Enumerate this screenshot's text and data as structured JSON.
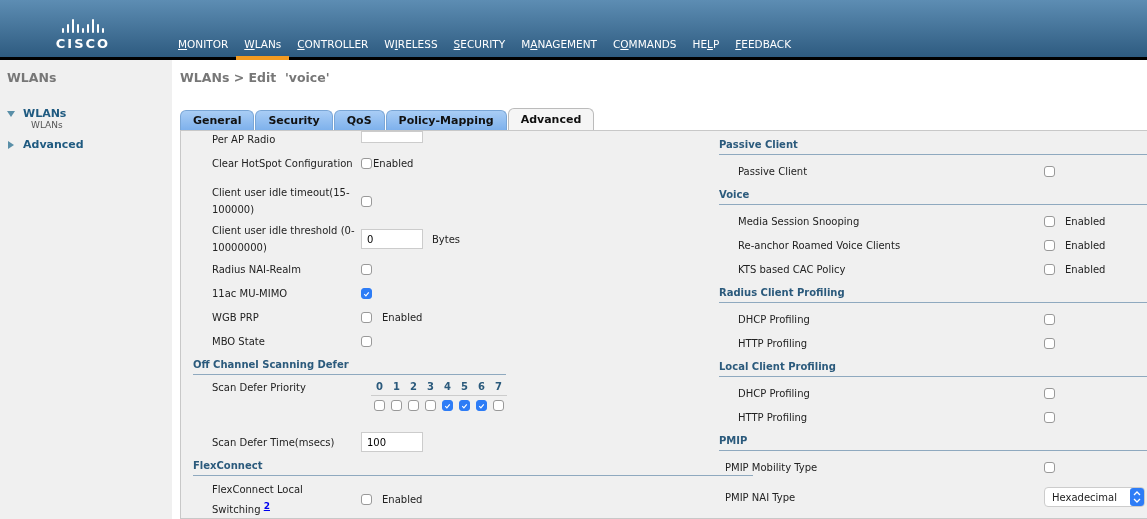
{
  "logo": "CISCO",
  "nav": [
    {
      "key": "M",
      "post": "ONITOR",
      "selected": false
    },
    {
      "key": "W",
      "post": "LANs",
      "selected": true
    },
    {
      "key": "C",
      "post": "ONTROLLER",
      "selected": false
    },
    {
      "pre": "W",
      "key": "I",
      "post": "RELESS",
      "selected": false
    },
    {
      "key": "S",
      "post": "ECURITY",
      "selected": false
    },
    {
      "pre": "M",
      "key": "A",
      "post": "NAGEMENT",
      "selected": false
    },
    {
      "pre": "C",
      "key": "O",
      "post": "MMANDS",
      "selected": false
    },
    {
      "pre": "HE",
      "key": "L",
      "post": "P",
      "selected": false
    },
    {
      "key": "F",
      "post": "EEDBACK",
      "selected": false
    }
  ],
  "sidebar": {
    "title": "WLANs",
    "items": [
      {
        "label": "WLANs",
        "expanded": true,
        "children": [
          {
            "label": "WLANs"
          }
        ]
      },
      {
        "label": "Advanced",
        "expanded": false
      }
    ]
  },
  "page_title": "WLANs > Edit  'voice'",
  "tabs": [
    {
      "label": "General",
      "selected": false
    },
    {
      "label": "Security",
      "selected": false
    },
    {
      "label": "QoS",
      "selected": false
    },
    {
      "label": "Policy-Mapping",
      "selected": false
    },
    {
      "label": "Advanced",
      "selected": true
    }
  ],
  "left": [
    {
      "kind": "input",
      "label": "Per AP Radio"
    },
    {
      "kind": "checkbox",
      "label": "Clear HotSpot Configuration",
      "checked": false,
      "enabled_text": "Enabled"
    },
    {
      "kind": "checkbox",
      "label": "Client user idle timeout(15-100000)",
      "checked": false
    },
    {
      "kind": "input",
      "label": "Client user idle threshold (0-10000000)",
      "value": "0",
      "suffix": "Bytes"
    },
    {
      "kind": "checkbox",
      "label": "Radius NAI-Realm",
      "checked": false
    },
    {
      "kind": "checkbox",
      "label": "11ac MU-MIMO",
      "checked": true
    },
    {
      "kind": "checkbox",
      "label": "WGB PRP",
      "checked": false,
      "enabled_text": "Enabled"
    },
    {
      "kind": "checkbox",
      "label": "MBO State",
      "checked": false
    },
    {
      "kind": "header",
      "label": "Off Channel Scanning Defer"
    },
    {
      "kind": "priority",
      "label": "Scan Defer Priority",
      "levels": [
        {
          "label": "0",
          "checked": false
        },
        {
          "label": "1",
          "checked": false
        },
        {
          "label": "2",
          "checked": false
        },
        {
          "label": "3",
          "checked": false
        },
        {
          "label": "4",
          "checked": true
        },
        {
          "label": "5",
          "checked": true
        },
        {
          "label": "6",
          "checked": true
        },
        {
          "label": "7",
          "checked": false
        }
      ]
    },
    {
      "kind": "input",
      "label": "Scan Defer Time(msecs)",
      "value": "100"
    },
    {
      "kind": "header",
      "label": "FlexConnect"
    },
    {
      "kind": "checkbox",
      "label": "FlexConnect Local Switching",
      "footnote": "2",
      "checked": false,
      "enabled_text": "Enabled"
    }
  ],
  "right": [
    {
      "kind": "header",
      "label": "Passive Client"
    },
    {
      "kind": "checkbox",
      "label": "Passive Client",
      "checked": false
    },
    {
      "kind": "header",
      "label": "Voice"
    },
    {
      "kind": "checkbox",
      "label": "Media Session Snooping",
      "checked": false,
      "enabled_text": "Enabled"
    },
    {
      "kind": "checkbox",
      "label": "Re-anchor Roamed Voice Clients",
      "checked": false,
      "enabled_text": "Enabled"
    },
    {
      "kind": "checkbox",
      "label": "KTS based CAC Policy",
      "checked": false,
      "enabled_text": "Enabled"
    },
    {
      "kind": "header",
      "label": "Radius Client Profiling"
    },
    {
      "kind": "checkbox",
      "label": "DHCP Profiling",
      "checked": false
    },
    {
      "kind": "checkbox",
      "label": "HTTP Profiling",
      "checked": false
    },
    {
      "kind": "header",
      "label": "Local Client Profiling"
    },
    {
      "kind": "checkbox",
      "label": "DHCP Profiling",
      "checked": false
    },
    {
      "kind": "checkbox",
      "label": "HTTP Profiling",
      "checked": false
    },
    {
      "kind": "header",
      "label": "PMIP"
    },
    {
      "kind": "checkbox",
      "label": "PMIP Mobility Type",
      "checked": false
    },
    {
      "kind": "select",
      "label": "PMIP NAI Type",
      "value": "Hexadecimal"
    }
  ]
}
